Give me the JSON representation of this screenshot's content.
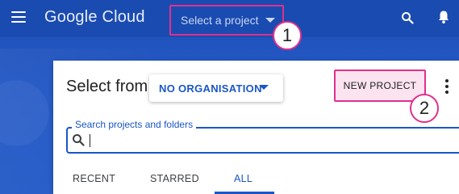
{
  "topbar": {
    "logo": "Google Cloud",
    "project_picker_label": "Select a project",
    "icons": [
      "menu-icon",
      "search-icon",
      "bell-icon"
    ]
  },
  "callouts": {
    "first": "1",
    "second": "2"
  },
  "dialog": {
    "title": "Select from",
    "organisation": "NO ORGANISATION",
    "new_project_label": "NEW PROJECT",
    "search_label": "Search projects and folders",
    "search_value": "",
    "tabs": [
      {
        "label": "RECENT",
        "active": false
      },
      {
        "label": "STARRED",
        "active": false
      },
      {
        "label": "ALL",
        "active": true
      }
    ]
  },
  "colors": {
    "header_blue": "#1a4bb0",
    "accent_blue": "#1a56c7",
    "highlight_pink": "#e0308c",
    "button_fill": "#fbe4ef"
  }
}
